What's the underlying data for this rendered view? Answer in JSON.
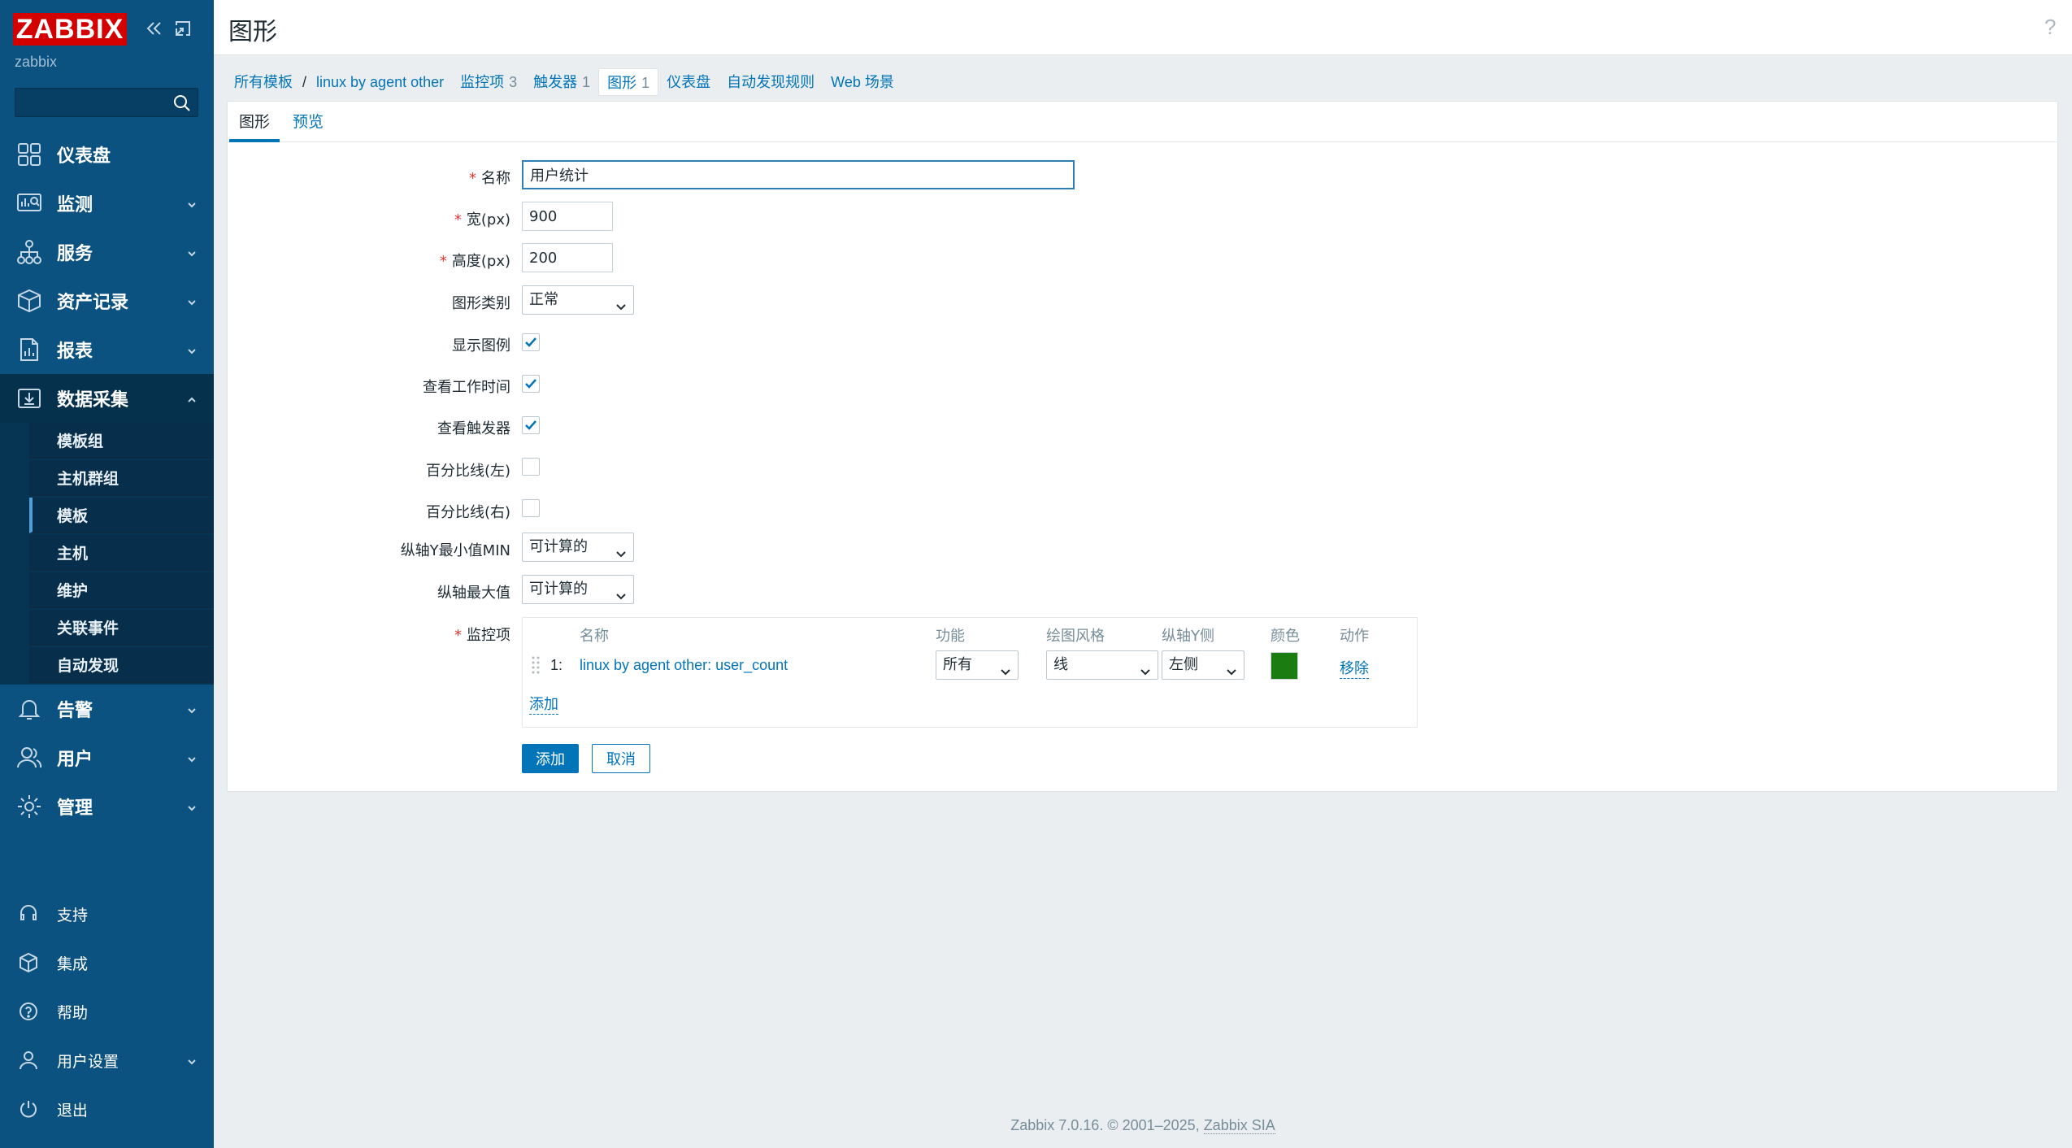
{
  "sidebar": {
    "logo": "ZABBIX",
    "server_name": "zabbix",
    "search_value": "",
    "nav": [
      {
        "label": "仪表盘",
        "icon": "dashboard-icon"
      },
      {
        "label": "监测",
        "icon": "monitoring-icon"
      },
      {
        "label": "服务",
        "icon": "services-icon"
      },
      {
        "label": "资产记录",
        "icon": "inventory-icon"
      },
      {
        "label": "报表",
        "icon": "reports-icon"
      },
      {
        "label": "数据采集",
        "icon": "data-collection-icon"
      },
      {
        "label": "告警",
        "icon": "alerts-icon"
      },
      {
        "label": "用户",
        "icon": "users-icon"
      },
      {
        "label": "管理",
        "icon": "administration-icon"
      }
    ],
    "submenu": [
      "模板组",
      "主机群组",
      "模板",
      "主机",
      "维护",
      "关联事件",
      "自动发现"
    ],
    "submenu_selected": "模板",
    "bottom": [
      {
        "label": "支持",
        "icon": "support-icon"
      },
      {
        "label": "集成",
        "icon": "integrations-icon"
      },
      {
        "label": "帮助",
        "icon": "help-icon"
      },
      {
        "label": "用户设置",
        "icon": "user-settings-icon"
      },
      {
        "label": "退出",
        "icon": "sign-out-icon"
      }
    ]
  },
  "header": {
    "title": "图形",
    "help": "?"
  },
  "breadcrumbs": {
    "all_templates": "所有模板",
    "separator": "/",
    "template": "linux by agent other",
    "items": {
      "label": "监控项",
      "count": "3"
    },
    "triggers": {
      "label": "触发器",
      "count": "1"
    },
    "graphs": {
      "label": "图形",
      "count": "1"
    },
    "dashboards": "仪表盘",
    "discovery": "自动发现规则",
    "web": "Web 场景"
  },
  "tabs": {
    "graph": "图形",
    "preview": "预览"
  },
  "form": {
    "name": {
      "label": "名称",
      "value": "用户统计"
    },
    "width": {
      "label": "宽(px)",
      "value": "900"
    },
    "height": {
      "label": "高度(px)",
      "value": "200"
    },
    "graph_type": {
      "label": "图形类别",
      "value": "正常"
    },
    "show_legend": {
      "label": "显示图例",
      "checked": true
    },
    "show_work_period": {
      "label": "查看工作时间",
      "checked": true
    },
    "show_triggers": {
      "label": "查看触发器",
      "checked": true
    },
    "percentile_left": {
      "label": "百分比线(左)",
      "checked": false
    },
    "percentile_right": {
      "label": "百分比线(右)",
      "checked": false
    },
    "ymin_type": {
      "label": "纵轴Y最小值MIN",
      "value": "可计算的"
    },
    "ymax_type": {
      "label": "纵轴最大值",
      "value": "可计算的"
    },
    "items_label": "监控项",
    "items_headers": {
      "name": "名称",
      "function": "功能",
      "draw_style": "绘图风格",
      "y_axis_side": "纵轴Y侧",
      "color": "颜色",
      "action": "动作"
    },
    "items": [
      {
        "num": "1:",
        "name": "linux by agent other: user_count",
        "function": "所有",
        "draw_style": "线",
        "y_axis_side": "左侧",
        "color": "#1A7C11",
        "action": "移除"
      }
    ],
    "add_item": "添加",
    "submit": "添加",
    "cancel": "取消"
  },
  "footer": {
    "text": "Zabbix 7.0.16. © 2001–2025, ",
    "link": "Zabbix SIA"
  },
  "colors": {
    "sidebar_bg": "#0B5280",
    "accent": "#0275B8",
    "logo_bg": "#D40000",
    "required": "#E33734"
  }
}
